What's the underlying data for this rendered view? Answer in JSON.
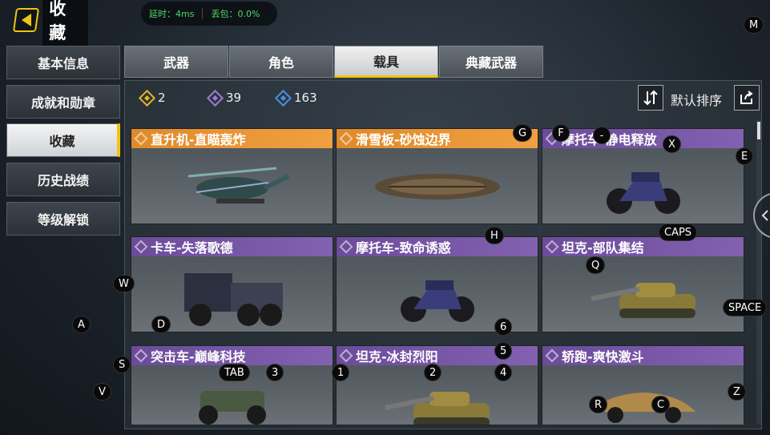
{
  "header": {
    "title": "收藏"
  },
  "net": {
    "latency": "延时：4ms",
    "loss": "丢包：0.0%"
  },
  "sidebar": {
    "items": [
      {
        "label": "基本信息"
      },
      {
        "label": "成就和勋章"
      },
      {
        "label": "收藏"
      },
      {
        "label": "历史战绩"
      },
      {
        "label": "等级解锁"
      }
    ],
    "active_index": 2
  },
  "tabs": {
    "items": [
      {
        "label": "武器"
      },
      {
        "label": "角色"
      },
      {
        "label": "载具"
      },
      {
        "label": "典藏武器"
      }
    ],
    "active_index": 2
  },
  "currencies": [
    {
      "value": "2",
      "color": "#e6b422",
      "icon": "gold-diamond-icon"
    },
    {
      "value": "39",
      "color": "#a07ad8",
      "icon": "purple-diamond-icon"
    },
    {
      "value": "163",
      "color": "#4a90e2",
      "icon": "blue-diamond-icon"
    }
  ],
  "sort": {
    "label": "默认排序"
  },
  "cards": [
    {
      "title": "直升机-直瞄轰炸",
      "rarity": "gold",
      "icon": "helicopter-icon"
    },
    {
      "title": "滑雪板-砂蚀边界",
      "rarity": "gold",
      "icon": "snowboard-icon"
    },
    {
      "title": "摩托车-静电释放",
      "rarity": "purple",
      "icon": "motorcycle-icon"
    },
    {
      "title": "卡车-失落歌德",
      "rarity": "purple",
      "icon": "truck-icon"
    },
    {
      "title": "摩托车-致命诱惑",
      "rarity": "purple",
      "icon": "motorcycle-icon"
    },
    {
      "title": "坦克-部队集结",
      "rarity": "purple",
      "icon": "tank-icon"
    },
    {
      "title": "突击车-巅峰科技",
      "rarity": "purple",
      "icon": "assault-vehicle-icon"
    },
    {
      "title": "坦克-冰封烈阳",
      "rarity": "purple",
      "icon": "tank-icon"
    },
    {
      "title": "轿跑-爽快激斗",
      "rarity": "purple",
      "icon": "sports-car-icon"
    }
  ],
  "keys": [
    "M",
    "G",
    "F",
    "-",
    "X",
    "E",
    "H",
    "CAPS",
    "Q",
    "W",
    "SPACE",
    "A",
    "D",
    "6",
    "5",
    "S",
    "TAB",
    "3",
    "1",
    "2",
    "4",
    "V",
    "Z",
    "R",
    "C"
  ]
}
